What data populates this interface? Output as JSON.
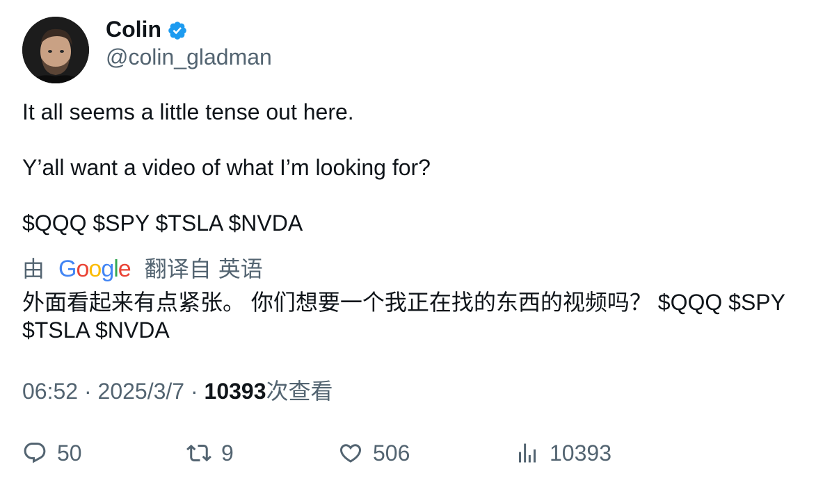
{
  "author": {
    "display_name": "Colin",
    "handle": "@colin_gladman",
    "verified": true,
    "verified_color": "#1d9bf0"
  },
  "tweet": {
    "line1": "It all seems a little tense out here.",
    "line2": "Y’all want a video of what I’m looking for?",
    "line3": "$QQQ $SPY $TSLA $NVDA"
  },
  "translation": {
    "prefix": "由",
    "provider": "Google",
    "label": "翻译自",
    "language": "英语",
    "text": "外面看起来有点紧张。 你们想要一个我正在找的东西的视频吗？ $QQQ $SPY $TSLA $NVDA"
  },
  "meta": {
    "time": "06:52",
    "separator": " · ",
    "date": "2025/3/7",
    "views": "10393",
    "views_label": "次查看"
  },
  "actions": {
    "replies": "50",
    "retweets": "9",
    "likes": "506",
    "views": "10393"
  },
  "colors": {
    "text": "#0f1419",
    "secondary": "#536471",
    "google_blue": "#4285F4",
    "google_red": "#EA4335",
    "google_yellow": "#FBBC05",
    "google_green": "#34A853"
  }
}
